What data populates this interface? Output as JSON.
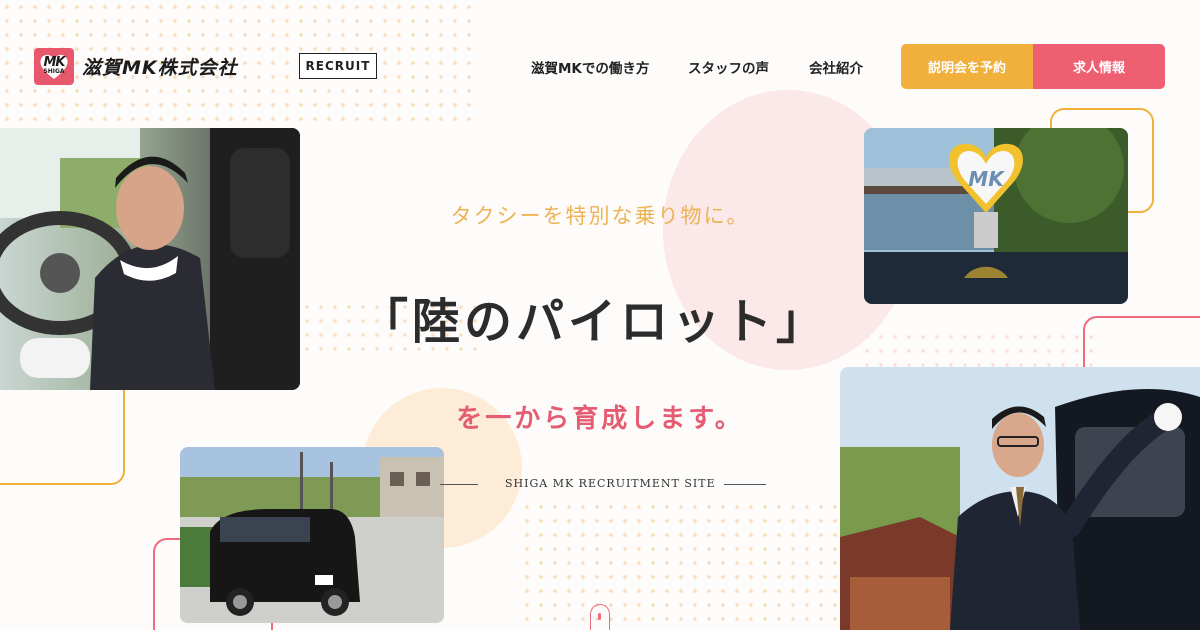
{
  "brand": {
    "logo_mark": "MK",
    "logo_sub": "SHIGA",
    "company_name": "滋賀MK株式会社",
    "recruit_badge": "RECRUIT"
  },
  "nav": {
    "items": [
      {
        "label": "滋賀MKでの働き方"
      },
      {
        "label": "スタッフの声"
      },
      {
        "label": "会社紹介"
      }
    ],
    "cta_briefing": "説明会を予約",
    "cta_jobs": "求人情報"
  },
  "hero": {
    "tagline": "タクシーを特別な乗り物に。",
    "headline": "「陸のパイロット」",
    "subline": "を一から育成します。",
    "site_label": "SHIGA MK RECRUITMENT SITE"
  },
  "photos": {
    "driver_portrait": {
      "icon": "driver-smiling-photo"
    },
    "mk_emblem": {
      "icon": "mk-roof-sign-photo",
      "emblem_text": "MK"
    },
    "van": {
      "icon": "black-van-photo"
    },
    "chauffeur": {
      "icon": "chauffeur-door-photo"
    }
  },
  "colors": {
    "accent_orange": "#f0b03b",
    "accent_pink": "#ee5f72",
    "tagline": "#edb355",
    "subline": "#e45d72"
  }
}
